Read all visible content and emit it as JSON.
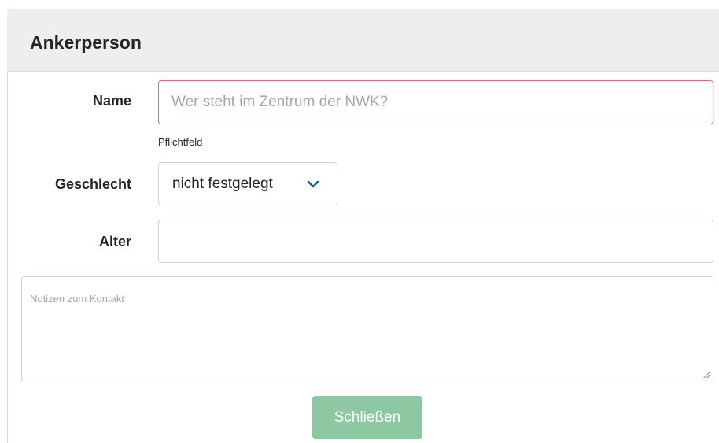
{
  "panel": {
    "title": "Ankerperson"
  },
  "form": {
    "name": {
      "label": "Name",
      "value": "",
      "placeholder": "Wer steht im Zentrum der NWK?",
      "hint": "Pflichtfeld"
    },
    "gender": {
      "label": "Geschlecht",
      "selected": "nicht festgelegt",
      "icon": "chevron-down-icon"
    },
    "age": {
      "label": "Alter",
      "value": ""
    },
    "notes": {
      "placeholder": "Notizen zum Kontakt"
    },
    "close_label": "Schließen"
  },
  "colors": {
    "header_bg": "#eeeeee",
    "invalid_border": "#e8677a",
    "button_bg": "#8ec8a2",
    "chevron": "#1a5a96"
  }
}
